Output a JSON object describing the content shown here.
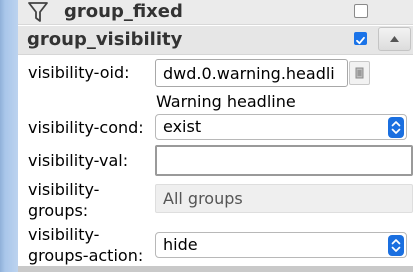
{
  "groups": {
    "group_fixed": {
      "label": "group_fixed",
      "checked": false
    },
    "group_visibility": {
      "label": "group_visibility",
      "checked": true
    }
  },
  "fields": {
    "visibility_oid": {
      "label": "visibility-oid:",
      "value": "dwd.0.warning.headli",
      "hint": "Warning headline"
    },
    "visibility_cond": {
      "label": "visibility-cond:",
      "value": "exist"
    },
    "visibility_val": {
      "label": "visibility-val:",
      "value": ""
    },
    "visibility_groups": {
      "label_line1": "visibility-",
      "label_line2": "groups:",
      "value": "All groups"
    },
    "visibility_groups_action": {
      "label_line1": "visibility-",
      "label_line2": "groups-action:",
      "value": "hide"
    }
  },
  "icons": {
    "filter": "filter-icon",
    "collapse": "chevron-up-icon",
    "oid_picker": "list-icon",
    "select_arrows": "updown-chevron-icon"
  },
  "colors": {
    "accent": "#1a73e8",
    "left_strip": "#a9c6ea"
  }
}
